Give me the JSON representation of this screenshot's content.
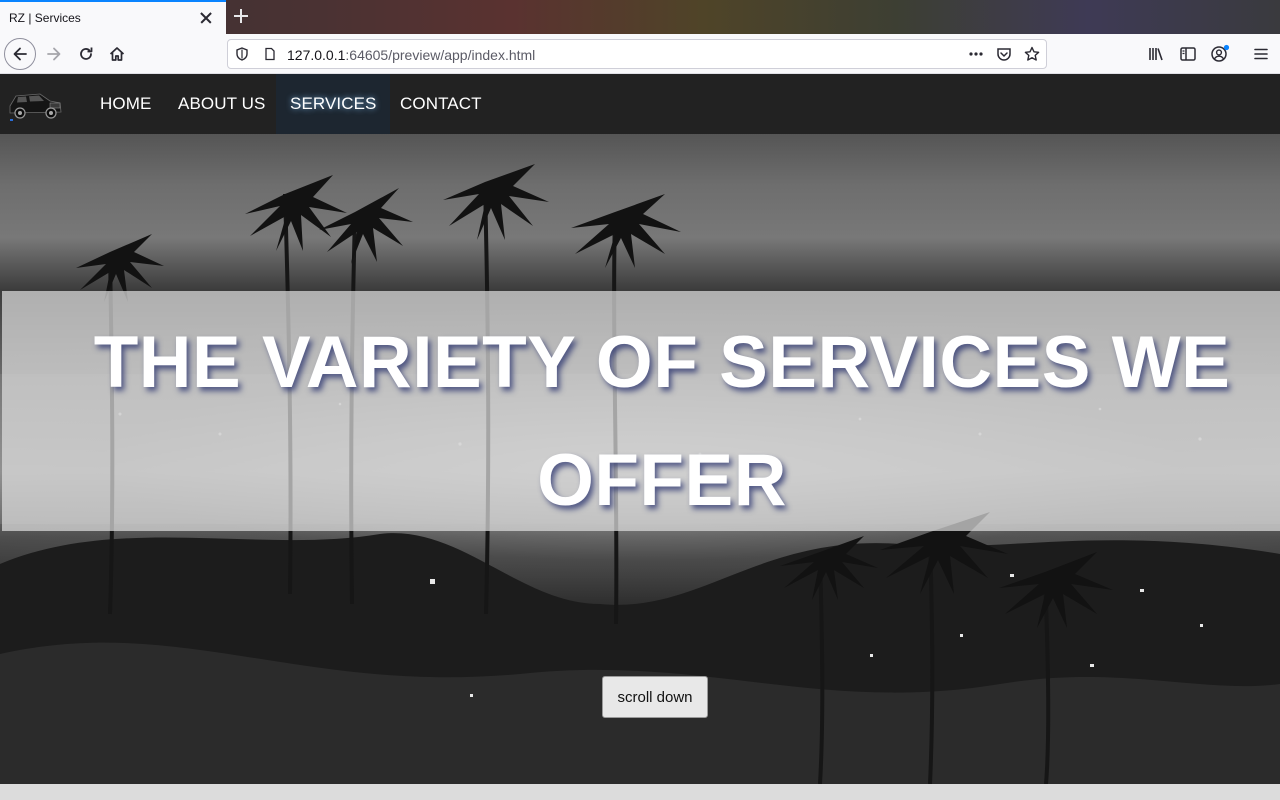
{
  "browser": {
    "tab_title": "RZ | Services",
    "url_host": "127.0.0.1",
    "url_rest": ":64605/preview/app/index.html",
    "icons": [
      "back-arrow-icon",
      "forward-arrow-icon",
      "reload-icon",
      "home-icon",
      "shield-icon",
      "page-icon",
      "more-icon",
      "pocket-icon",
      "star-icon",
      "library-icon",
      "sidebar-icon",
      "account-icon",
      "menu-icon"
    ]
  },
  "site": {
    "nav": [
      {
        "label": "HOME"
      },
      {
        "label": "ABOUT US"
      },
      {
        "label": "SERVICES",
        "active": true
      },
      {
        "label": "CONTACT"
      }
    ],
    "hero_title": "THE VARIETY OF SERVICES WE OFFER",
    "scroll_button": "scroll down"
  },
  "colors": {
    "nav_bg": "#222222",
    "active_nav_bg": "#1d2630",
    "tab_accent": "#0a84ff"
  }
}
